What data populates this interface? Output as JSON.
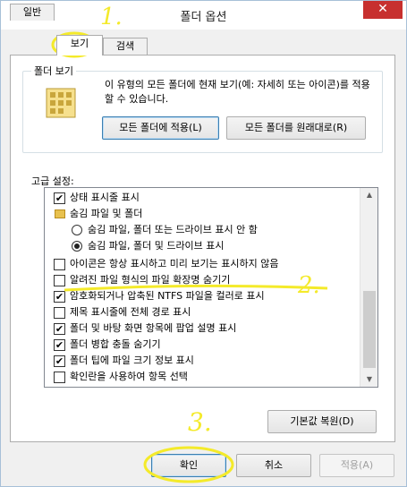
{
  "window": {
    "title": "폴더 옵션",
    "close_glyph": "✕"
  },
  "tabs": [
    {
      "label": "일반"
    },
    {
      "label": "보기"
    },
    {
      "label": "검색"
    }
  ],
  "folder_view": {
    "group_label": "폴더 보기",
    "description": "이 유형의 모든 폴더에 현재 보기(예: 자세히 또는 아이콘)를 적용할 수 있습니다.",
    "apply_button": "모든 폴더에 적용(L)",
    "reset_button": "모든 폴더를 원래대로(R)"
  },
  "advanced": {
    "label": "고급 설정:",
    "items": [
      {
        "type": "checkbox",
        "checked": true,
        "label": "상태 표시줄 표시"
      },
      {
        "type": "folder",
        "label": "숨김 파일 및 폴더"
      },
      {
        "type": "radio",
        "selected": false,
        "label": "숨김 파일, 폴더 또는 드라이브 표시 안 함"
      },
      {
        "type": "radio",
        "selected": true,
        "label": "숨김 파일, 폴더 및 드라이브 표시"
      },
      {
        "type": "checkbox",
        "checked": false,
        "label": "아이콘은 항상 표시하고 미리 보기는 표시하지 않음"
      },
      {
        "type": "checkbox",
        "checked": false,
        "label": "알려진 파일 형식의 파일 확장명 숨기기"
      },
      {
        "type": "checkbox",
        "checked": true,
        "label": "암호화되거나 압축된 NTFS 파일을 컬러로 표시"
      },
      {
        "type": "checkbox",
        "checked": false,
        "label": "제목 표시줄에 전체 경로 표시"
      },
      {
        "type": "checkbox",
        "checked": true,
        "label": "폴더 및 바탕 화면 항목에 팝업 설명 표시"
      },
      {
        "type": "checkbox",
        "checked": true,
        "label": "폴더 병합 충돌 숨기기"
      },
      {
        "type": "checkbox",
        "checked": true,
        "label": "폴더 팁에 파일 크기 정보 표시"
      },
      {
        "type": "checkbox",
        "checked": false,
        "label": "확인란을 사용하여 항목 선택"
      }
    ],
    "restore_defaults_button": "기본값 복원(D)"
  },
  "footer": {
    "ok_button": "확인",
    "cancel_button": "취소",
    "apply_button": "적용(A)"
  },
  "annotations": {
    "step1": "1.",
    "step2": "2.",
    "step3": "3.",
    "color": "#f4ea2a"
  }
}
